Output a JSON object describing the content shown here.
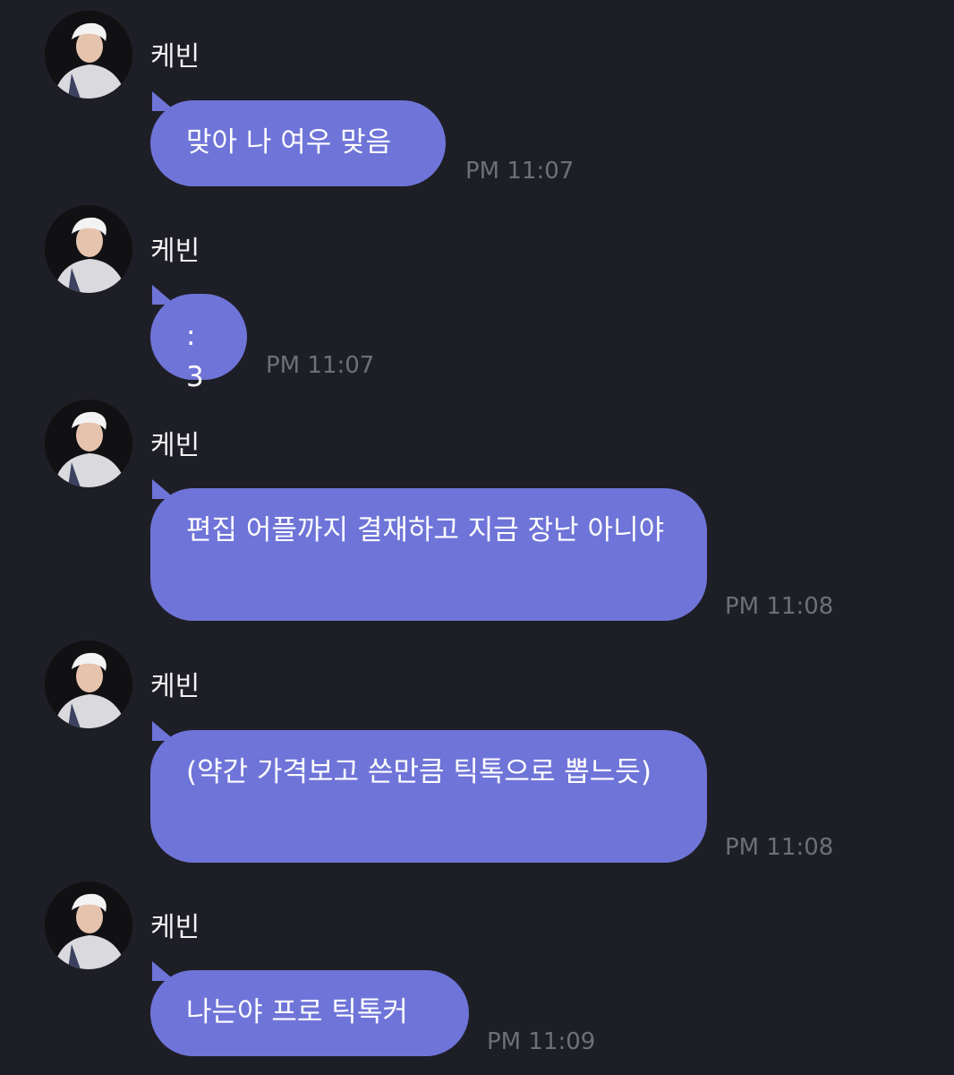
{
  "messages": [
    {
      "sender": "케빈",
      "text": "맞아 나 여우 맞음",
      "time": "PM 11:07"
    },
    {
      "sender": "케빈",
      "text": ":3",
      "time": "PM 11:07"
    },
    {
      "sender": "케빈",
      "text": "편집 어플까지 결재하고 지금 장난 아니야",
      "time": "PM 11:08"
    },
    {
      "sender": "케빈",
      "text": "(약간 가격보고 쓴만큼 틱톡으로 뽑느듯)",
      "time": "PM 11:08"
    },
    {
      "sender": "케빈",
      "text": "나는야 프로 틱톡커",
      "time": "PM 11:09"
    }
  ],
  "colors": {
    "background": "#1e1e26",
    "bubble": "#6f74d8",
    "bubble_text": "#ffffff",
    "sender_text": "#f2f2f4",
    "timestamp_text": "#6e6f79"
  }
}
